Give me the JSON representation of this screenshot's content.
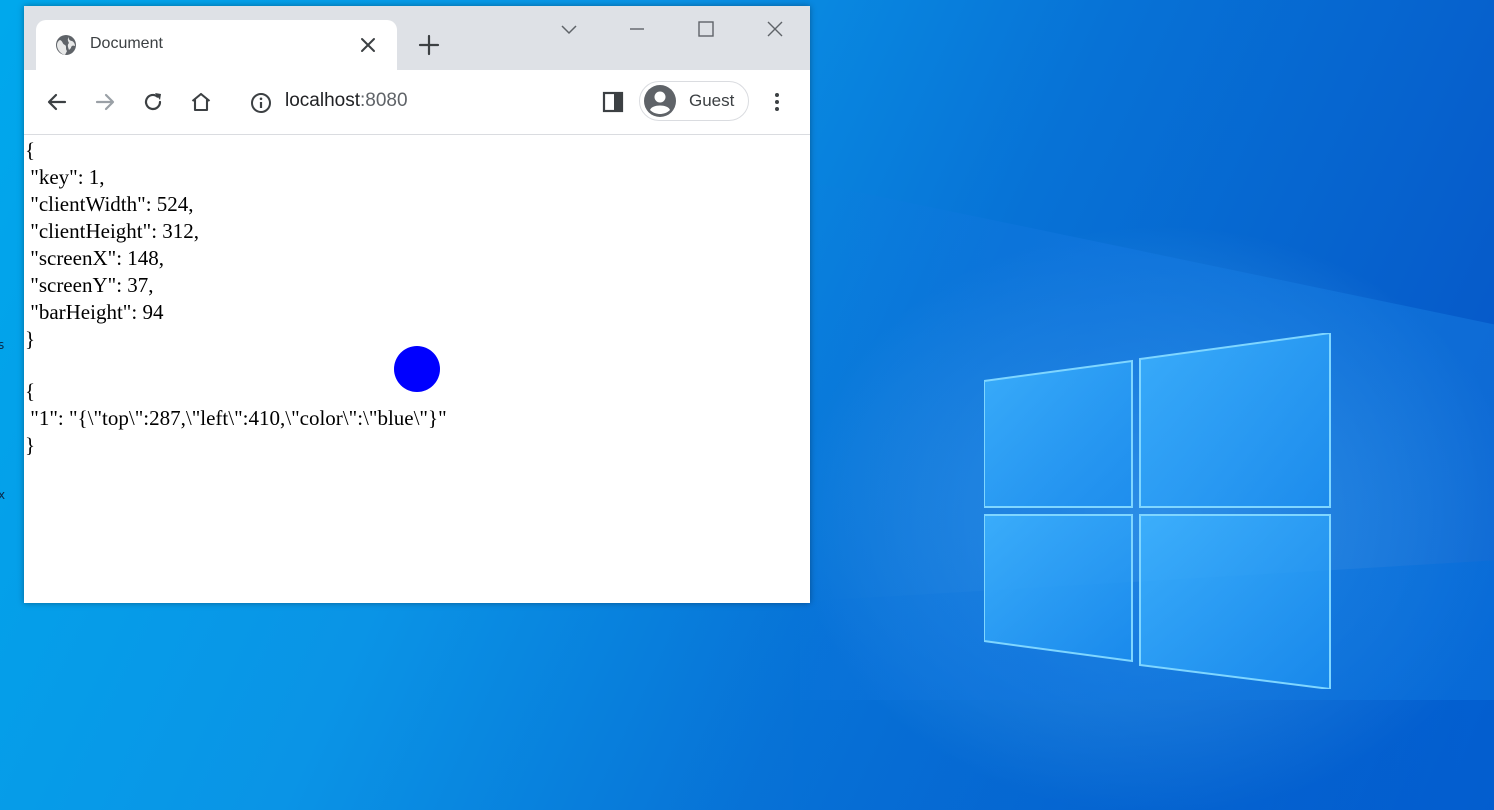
{
  "browser": {
    "tab": {
      "title": "Document"
    },
    "address": {
      "host": "localhost",
      "port": ":8080"
    },
    "profile": {
      "name": "Guest"
    }
  },
  "page": {
    "state_json": [
      "{",
      " \"key\": 1,",
      " \"clientWidth\": 524,",
      " \"clientHeight\": 312,",
      " \"screenX\": 148,",
      " \"screenY\": 37,",
      " \"barHeight\": 94",
      "}"
    ],
    "shapes_json": [
      "{",
      " \"1\": \"{\\\"top\\\":287,\\\"left\\\":410,\\\"color\\\":\\\"blue\\\"}\"",
      "}"
    ],
    "dot_color": "#0000ff"
  },
  "desktop": {
    "edge_glyph_1": "s",
    "edge_glyph_2": "x"
  },
  "colors": {
    "tabstrip": "#dee1e6",
    "icon": "#5f6368",
    "desktop_accent": "#0a7ad6"
  }
}
